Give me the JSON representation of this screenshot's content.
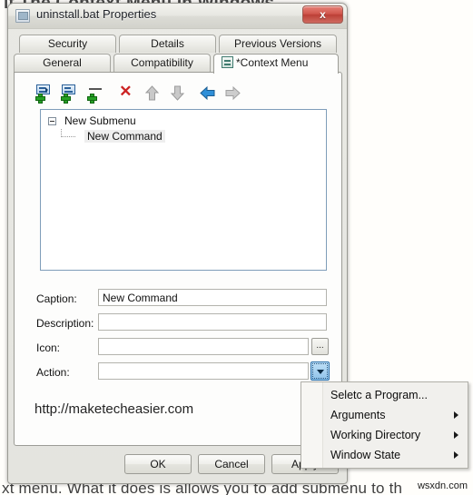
{
  "background": {
    "top_text": "it The Context Menu In Windows",
    "bottom_text": "xt menu. What it does is allows you to add submenu to th",
    "corner_watermark": "wsxdn.com"
  },
  "dialog": {
    "title": "uninstall.bat Properties",
    "title_icon": "file-properties-icon",
    "close_label": "x",
    "tabs_row1": [
      {
        "label": "Security",
        "active": false
      },
      {
        "label": "Details",
        "active": false
      },
      {
        "label": "Previous Versions",
        "active": false
      }
    ],
    "tabs_row2": [
      {
        "label": "General",
        "active": false
      },
      {
        "label": "Compatibility",
        "active": false
      },
      {
        "label": "*Context Menu",
        "active": true,
        "icon": "context-menu-icon"
      }
    ],
    "toolbar": [
      {
        "name": "add-submenu-button",
        "tooltip": "Add Submenu"
      },
      {
        "name": "add-command-button",
        "tooltip": "Add Command"
      },
      {
        "name": "add-separator-button",
        "tooltip": "Add Separator"
      },
      {
        "name": "delete-button",
        "tooltip": "Delete"
      },
      {
        "name": "move-up-button",
        "tooltip": "Move Up"
      },
      {
        "name": "move-down-button",
        "tooltip": "Move Down"
      },
      {
        "name": "move-left-button",
        "tooltip": "Move Left"
      },
      {
        "name": "move-right-button",
        "tooltip": "Move Right"
      }
    ],
    "tree": {
      "root_label": "New Submenu",
      "child_label": "New Command",
      "child_selected": true,
      "expanded": true
    },
    "form": {
      "caption_label": "Caption:",
      "caption_value": "New Command",
      "description_label": "Description:",
      "description_value": "",
      "description_placeholder": "",
      "icon_label": "Icon:",
      "icon_value": "",
      "icon_browse_label": "...",
      "action_label": "Action:",
      "action_value": "",
      "action_dropdown_label": "▼"
    },
    "watermark": "http://maketecheasier.com",
    "buttons": {
      "ok": "OK",
      "cancel": "Cancel",
      "apply": "Apply"
    }
  },
  "context_menu": {
    "items": [
      {
        "label": "Seletc a Program...",
        "has_submenu": false
      },
      {
        "label": "Arguments",
        "has_submenu": true
      },
      {
        "label": "Working Directory",
        "has_submenu": true
      },
      {
        "label": "Window State",
        "has_submenu": true
      }
    ]
  },
  "colors": {
    "accent_blue": "#2a6ea8",
    "close_red": "#cf6a60",
    "add_green": "#25a025",
    "delete_red": "#cc2222"
  }
}
